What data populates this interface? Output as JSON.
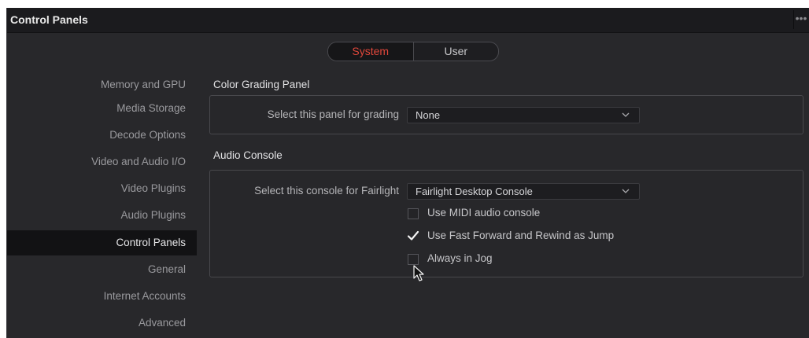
{
  "window": {
    "title": "Control Panels",
    "menu_glyph": "•••"
  },
  "tabs": {
    "items": [
      {
        "label": "System",
        "active": true
      },
      {
        "label": "User",
        "active": false
      }
    ],
    "active_color": "#e0473b"
  },
  "sidebar": {
    "items": [
      {
        "label": "Memory and GPU",
        "selected": false
      },
      {
        "label": "Media Storage",
        "selected": false
      },
      {
        "label": "Decode Options",
        "selected": false
      },
      {
        "label": "Video and Audio I/O",
        "selected": false
      },
      {
        "label": "Video Plugins",
        "selected": false
      },
      {
        "label": "Audio Plugins",
        "selected": false
      },
      {
        "label": "Control Panels",
        "selected": true
      },
      {
        "label": "General",
        "selected": false
      },
      {
        "label": "Internet Accounts",
        "selected": false
      },
      {
        "label": "Advanced",
        "selected": false
      }
    ]
  },
  "color_grading": {
    "title": "Color Grading Panel",
    "label": "Select this panel for grading",
    "value": "None",
    "icon": "chevron-down-icon"
  },
  "audio_console": {
    "title": "Audio Console",
    "label": "Select this console for Fairlight",
    "value": "Fairlight Desktop Console",
    "icon": "chevron-down-icon",
    "options": [
      {
        "label": "Use MIDI audio console",
        "checked": false
      },
      {
        "label": "Use Fast Forward and Rewind as Jump",
        "checked": true
      },
      {
        "label": "Always in Jog",
        "checked": false
      }
    ]
  },
  "pointer": {
    "icon": "mouse-pointer-icon"
  }
}
